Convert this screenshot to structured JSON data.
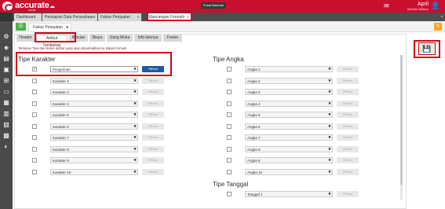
{
  "app": {
    "logo_text": "accurate",
    "logo_sub": "ONLINE",
    "help_label": "Pusat Bantuan",
    "user_name": "April",
    "user_sub": "Michelle Williams"
  },
  "main_tabs": [
    {
      "label": "Dashboard"
    },
    {
      "label": "Persiapan Data Perusahaan"
    },
    {
      "label": "Faktur Penjualan"
    },
    {
      "label": "Rancangan Formulir"
    }
  ],
  "doc_tab": {
    "label": "Faktur Penjualan"
  },
  "sub_tabs": [
    {
      "label": "Header"
    },
    {
      "label": "Atribut Tambahan"
    },
    {
      "label": "Rincian"
    },
    {
      "label": "Biaya"
    },
    {
      "label": "Uang Muka"
    },
    {
      "label": "Info lainnya"
    },
    {
      "label": "Footer"
    }
  ],
  "description": "Tentukan Tipe dan Nama atribut yang akan ditambahkan ke dalam formulir",
  "pick_label": "Pilihan",
  "sections": {
    "karakter": {
      "title": "Tipe Karakter",
      "rows": [
        {
          "value": "Pengiriman",
          "checked": true
        },
        {
          "placeholder": "Karakter 2"
        },
        {
          "placeholder": "Karakter 3"
        },
        {
          "placeholder": "Karakter 4"
        },
        {
          "placeholder": "Karakter 5"
        },
        {
          "placeholder": "Karakter 6"
        },
        {
          "placeholder": "Karakter 7"
        },
        {
          "placeholder": "Karakter 8"
        },
        {
          "placeholder": "Karakter 9"
        },
        {
          "placeholder": "Karakter 10"
        }
      ]
    },
    "angka": {
      "title": "Tipe Angka",
      "rows": [
        {
          "placeholder": "Angka 1"
        },
        {
          "placeholder": "Angka 2"
        },
        {
          "placeholder": "Angka 3"
        },
        {
          "placeholder": "Angka 4"
        },
        {
          "placeholder": "Angka 5"
        },
        {
          "placeholder": "Angka 6"
        },
        {
          "placeholder": "Angka 7"
        },
        {
          "placeholder": "Angka 8"
        },
        {
          "placeholder": "Angka 9"
        },
        {
          "placeholder": "Angka 10"
        }
      ]
    },
    "tanggal": {
      "title": "Tipe Tanggal",
      "rows": [
        {
          "placeholder": "Tanggal 1"
        }
      ]
    }
  },
  "icons": {
    "menu": "list-icon",
    "save": "save-icon",
    "flag": "flag-icon",
    "notif": "bell-icon",
    "user": "user-icon"
  },
  "colors": {
    "brand": "#c8102e",
    "highlight": "#d0021b",
    "primary_button": "#1e5aa8"
  }
}
